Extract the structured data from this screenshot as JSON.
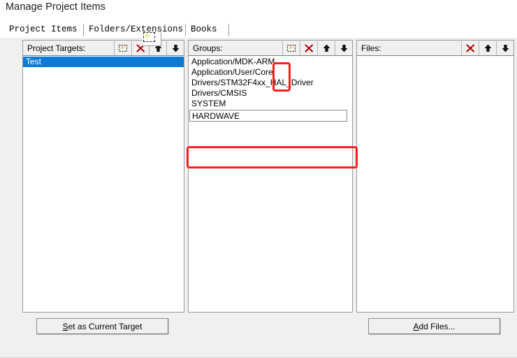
{
  "dialog": {
    "title": "Manage Project Items"
  },
  "tabs": [
    {
      "label": "Project Items",
      "active": true
    },
    {
      "label": "Folders/Extensions",
      "active": false
    },
    {
      "label": "Books",
      "active": false
    }
  ],
  "panels": {
    "targets": {
      "title": "Project Targets:",
      "toolbar": [
        {
          "name": "new-item-icon",
          "tooltip": "New (Insert)"
        },
        {
          "name": "delete-icon",
          "tooltip": "Remove"
        },
        {
          "name": "move-up-icon",
          "tooltip": "Move Up"
        },
        {
          "name": "move-down-icon",
          "tooltip": "Move Down"
        }
      ],
      "items": [
        {
          "label": "Test",
          "selected": true
        }
      ]
    },
    "groups": {
      "title": "Groups:",
      "toolbar": [
        {
          "name": "new-item-icon",
          "tooltip": "New (Insert)"
        },
        {
          "name": "delete-icon",
          "tooltip": "Remove"
        },
        {
          "name": "move-up-icon",
          "tooltip": "Move Up"
        },
        {
          "name": "move-down-icon",
          "tooltip": "Move Down"
        }
      ],
      "items": [
        {
          "label": "Application/MDK-ARM",
          "selected": false
        },
        {
          "label": "Application/User/Core",
          "selected": false
        },
        {
          "label": "Drivers/STM32F4xx_HAL_Driver",
          "selected": false
        },
        {
          "label": "Drivers/CMSIS",
          "selected": false
        },
        {
          "label": "SYSTEM",
          "selected": false
        }
      ],
      "editing_item": {
        "value": "HARDWAVE",
        "placeholder": ""
      }
    },
    "files": {
      "title": "Files:",
      "toolbar": [
        {
          "name": "delete-icon",
          "tooltip": "Remove"
        },
        {
          "name": "move-up-icon",
          "tooltip": "Move Up"
        },
        {
          "name": "move-down-icon",
          "tooltip": "Move Down"
        }
      ],
      "items": []
    }
  },
  "buttons": {
    "set_current_target": {
      "prefix": "S",
      "label": "et as Current Target"
    },
    "add_files": {
      "prefix": "A",
      "label": "dd Files..."
    }
  },
  "annotations": {
    "highlight_color": "#fb1e1e",
    "boxes": [
      {
        "name": "new-group-button-highlight"
      },
      {
        "name": "new-group-name-highlight"
      }
    ]
  },
  "colors": {
    "selection": "#0a7ad6",
    "dialog_background": "#f0f0f0",
    "list_background": "#ffffff"
  }
}
